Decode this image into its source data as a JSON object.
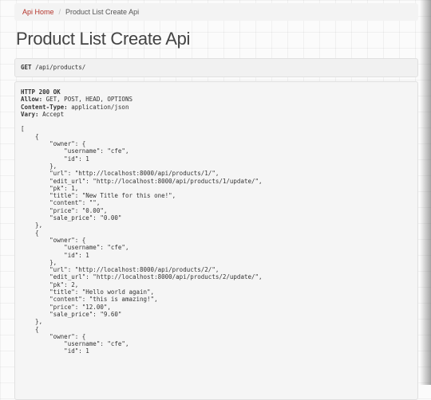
{
  "breadcrumb": {
    "home_label": "Api Home",
    "separator": "/",
    "current_label": "Product List Create Api"
  },
  "page": {
    "title": "Product List Create Api"
  },
  "request": {
    "method": "GET",
    "path": "/api/products/"
  },
  "response": {
    "status_line": "HTTP 200 OK",
    "headers": [
      {
        "name": "Allow:",
        "value": "GET, POST, HEAD, OPTIONS"
      },
      {
        "name": "Content-Type:",
        "value": "application/json"
      },
      {
        "name": "Vary:",
        "value": "Accept"
      }
    ],
    "body_lines": [
      "[",
      "    {",
      "        \"owner\": {",
      "            \"username\": \"cfe\",",
      "            \"id\": 1",
      "        },",
      "        \"url\": \"http://localhost:8000/api/products/1/\",",
      "        \"edit_url\": \"http://localhost:8000/api/products/1/update/\",",
      "        \"pk\": 1,",
      "        \"title\": \"New Title for this one!\",",
      "        \"content\": \"\",",
      "        \"price\": \"0.00\",",
      "        \"sale_price\": \"0.00\"",
      "    },",
      "    {",
      "        \"owner\": {",
      "            \"username\": \"cfe\",",
      "            \"id\": 1",
      "        },",
      "        \"url\": \"http://localhost:8000/api/products/2/\",",
      "        \"edit_url\": \"http://localhost:8000/api/products/2/update/\",",
      "        \"pk\": 2,",
      "        \"title\": \"Hello world again\",",
      "        \"content\": \"this is amazing!\",",
      "        \"price\": \"12.00\",",
      "        \"sale_price\": \"9.60\"",
      "    },",
      "    {",
      "        \"owner\": {",
      "            \"username\": \"cfe\",",
      "            \"id\": 1"
    ]
  },
  "colors": {
    "link": "#b5362d",
    "string_value": "#8b1a1a",
    "panel_bg": "#f5f5f5"
  }
}
